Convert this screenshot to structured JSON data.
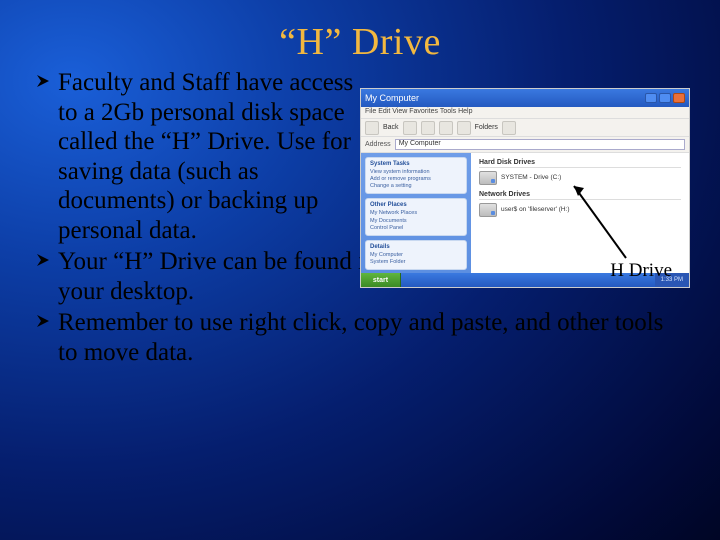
{
  "title": "“H” Drive",
  "bullets": [
    "Faculty and Staff have access to a 2Gb personal disk space called the “H” Drive.  Use for saving data (such as documents) or backing up personal data.",
    "Your “H” Drive can be found in the “My Computer” icon on your desktop.",
    "Remember to use right click, copy and paste, and other tools to move data."
  ],
  "caption": "H Drive",
  "mycomputer": {
    "window_title": "My Computer",
    "menus": "File  Edit  View  Favorites  Tools  Help",
    "toolbar_back": "Back",
    "toolbar_folders": "Folders",
    "address_label": "Address",
    "address_value": "My Computer",
    "side_groups": [
      {
        "hdr": "System Tasks",
        "lines": [
          "View system information",
          "Add or remove programs",
          "Change a setting"
        ]
      },
      {
        "hdr": "Other Places",
        "lines": [
          "My Network Places",
          "My Documents",
          "Control Panel"
        ]
      },
      {
        "hdr": "Details",
        "lines": [
          "My Computer",
          "System Folder"
        ]
      }
    ],
    "section_hdd": "Hard Disk Drives",
    "drive_c": "SYSTEM - Drive (C:)",
    "section_net": "Network Drives",
    "drive_h": "user$ on 'fileserver' (H:)",
    "start": "start",
    "tray_time": "1:33 PM"
  }
}
